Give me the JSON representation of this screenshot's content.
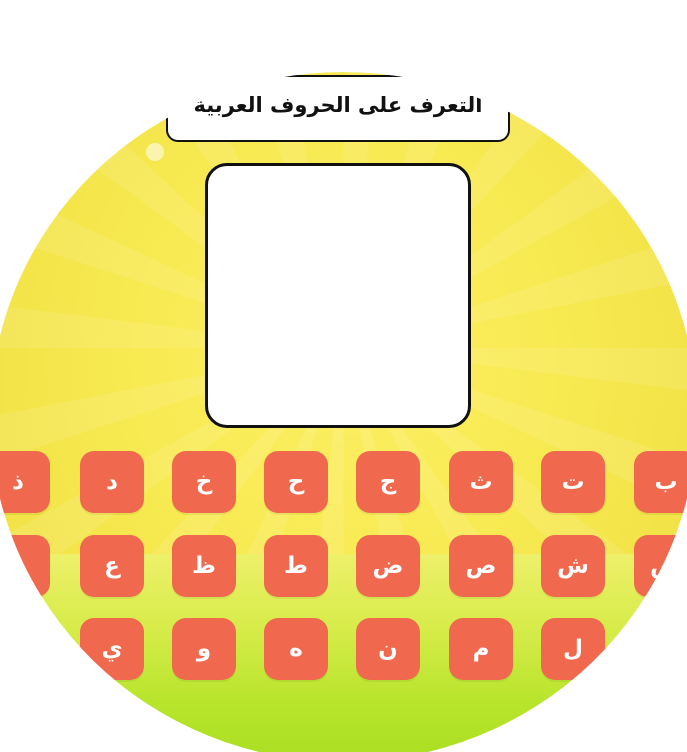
{
  "header": {
    "title": "التعرف على الحروف العربيةَ"
  },
  "image_area": {
    "content": ""
  },
  "colors": {
    "background": "#f8ea52",
    "tile": "#f0694e",
    "tile_text": "#ffffff",
    "ground": "#b9e52d"
  },
  "letters": {
    "row1": [
      "ذ",
      "د",
      "خ",
      "ح",
      "ج",
      "ث",
      "ت",
      "ب"
    ],
    "row2": [
      "غ",
      "ع",
      "ظ",
      "ط",
      "ض",
      "ص",
      "ش",
      "س"
    ],
    "row3": [
      "ي",
      "و",
      "ه",
      "ن",
      "م",
      "ل"
    ]
  }
}
